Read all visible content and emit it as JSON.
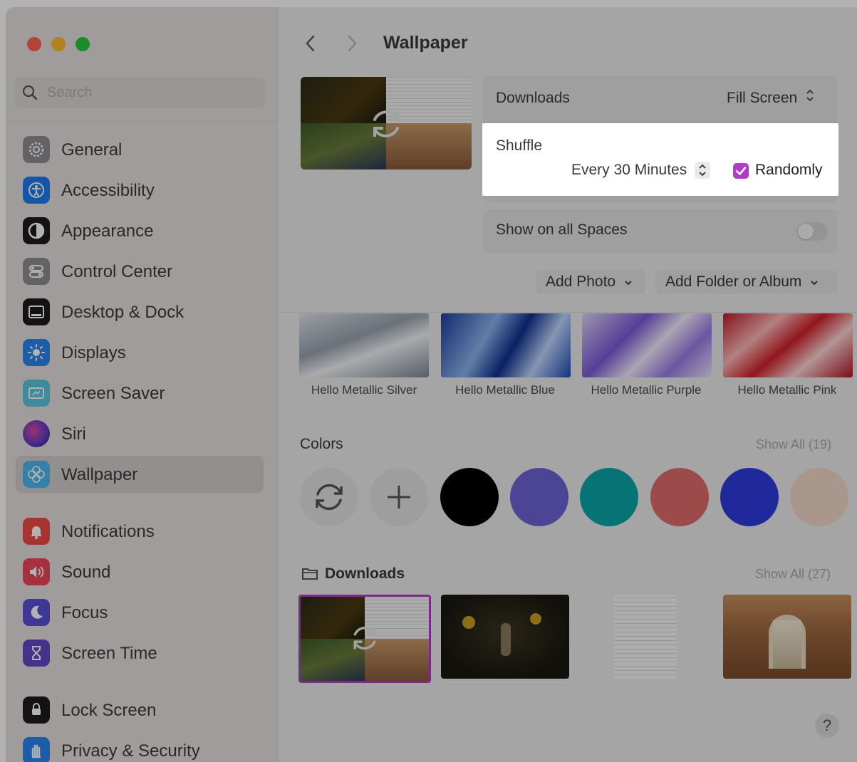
{
  "window": {
    "title": "Wallpaper"
  },
  "search": {
    "placeholder": "Search"
  },
  "sidebar": {
    "items": [
      {
        "label": "General",
        "icon": "gear-icon",
        "color": "#8e8e93"
      },
      {
        "label": "Accessibility",
        "icon": "accessibility-icon",
        "color": "#1e7cf2"
      },
      {
        "label": "Appearance",
        "icon": "appearance-icon",
        "color": "#1c1c1e"
      },
      {
        "label": "Control Center",
        "icon": "control-center-icon",
        "color": "#8e8e93"
      },
      {
        "label": "Desktop & Dock",
        "icon": "dock-icon",
        "color": "#1c1c1e"
      },
      {
        "label": "Displays",
        "icon": "sun-icon",
        "color": "#2a84f0"
      },
      {
        "label": "Screen Saver",
        "icon": "screen-saver-icon",
        "color": "#5ac8e0"
      },
      {
        "label": "Siri",
        "icon": "siri-icon",
        "color": "#6a3cc0"
      },
      {
        "label": "Wallpaper",
        "icon": "flower-icon",
        "color": "#4cb8f0"
      },
      {
        "label": "Notifications",
        "icon": "bell-icon",
        "color": "#f04a4a"
      },
      {
        "label": "Sound",
        "icon": "speaker-icon",
        "color": "#f0455a"
      },
      {
        "label": "Focus",
        "icon": "moon-icon",
        "color": "#5b4fd6"
      },
      {
        "label": "Screen Time",
        "icon": "hourglass-icon",
        "color": "#6248c8"
      },
      {
        "label": "Lock Screen",
        "icon": "lock-icon",
        "color": "#1c1c1e"
      },
      {
        "label": "Privacy & Security",
        "icon": "hand-icon",
        "color": "#2a84f0"
      }
    ]
  },
  "wallpaper": {
    "source": "Downloads",
    "fit": "Fill Screen",
    "shuffle_label": "Shuffle",
    "interval": "Every 30 Minutes",
    "randomly_label": "Randomly",
    "randomly_checked": true,
    "show_spaces_label": "Show on all Spaces",
    "show_spaces_enabled": false,
    "add_photo": "Add Photo",
    "add_folder": "Add Folder or Album"
  },
  "dynamic": {
    "items": [
      {
        "label": "Hello Metallic Silver"
      },
      {
        "label": "Hello Metallic Blue"
      },
      {
        "label": "Hello Metallic Purple"
      },
      {
        "label": "Hello Metallic Pink"
      }
    ]
  },
  "colors": {
    "title": "Colors",
    "show_all": "Show All (19)",
    "swatches": [
      "#000000",
      "#6e62d6",
      "#0aa6a6",
      "#e06a6a",
      "#2f3be0",
      "#f2d8c8"
    ]
  },
  "downloads": {
    "title": "Downloads",
    "show_all": "Show All (27)"
  },
  "help_label": "?"
}
